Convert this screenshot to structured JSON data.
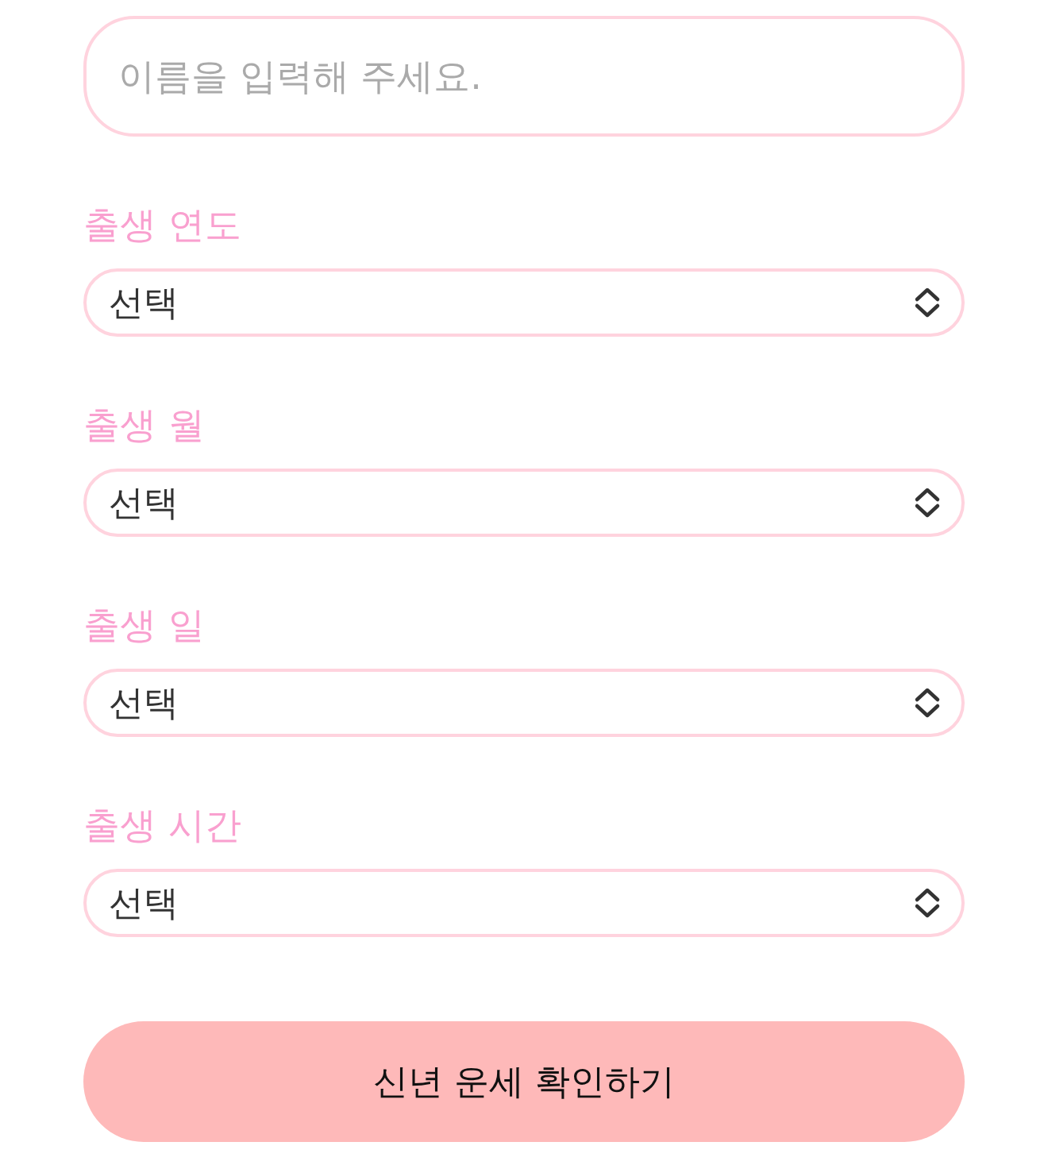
{
  "name_field": {
    "placeholder": "이름을 입력해 주세요."
  },
  "fields": [
    {
      "label": "출생 연도",
      "value": "선택"
    },
    {
      "label": "출생 월",
      "value": "선택"
    },
    {
      "label": "출생 일",
      "value": "선택"
    },
    {
      "label": "출생 시간",
      "value": "선택"
    }
  ],
  "submit_button": {
    "label": "신년 운세 확인하기"
  }
}
